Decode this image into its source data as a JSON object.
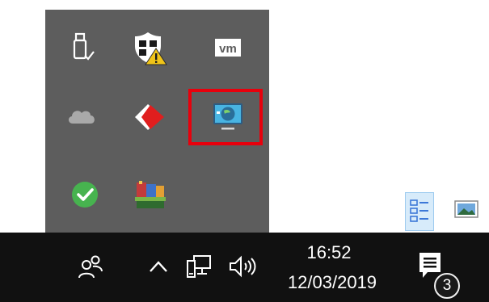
{
  "tray_overflow": {
    "icons": [
      {
        "name": "usb-safely-remove-icon"
      },
      {
        "name": "windows-security-warning-icon"
      },
      {
        "name": "vmware-icon",
        "label": "vm"
      },
      {
        "name": "onedrive-icon"
      },
      {
        "name": "red-diamond-app-icon"
      },
      {
        "name": "network-monitor-app-icon",
        "highlighted": true
      },
      {
        "name": "green-check-icon"
      },
      {
        "name": "winrar-icon"
      }
    ],
    "highlight_color": "#e8000c"
  },
  "taskbar": {
    "background": "#111111",
    "icons": [
      "people-icon",
      "chevron-up-icon",
      "network-icon",
      "volume-icon",
      "action-center-icon"
    ],
    "clock": {
      "time": "16:52",
      "date": "12/03/2019"
    },
    "notification_count": "3"
  }
}
